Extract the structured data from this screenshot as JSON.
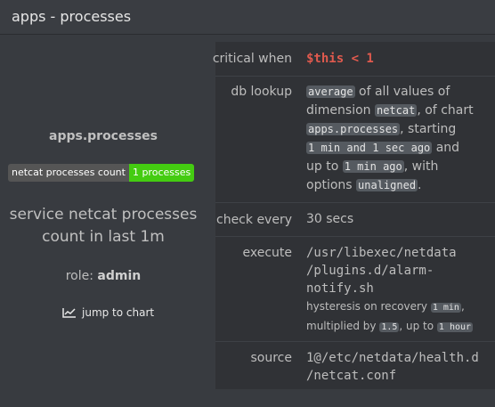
{
  "header": {
    "title": "apps - processes"
  },
  "left": {
    "chart_name": "apps.processes",
    "badge_label": "netcat processes count",
    "badge_value": "1 processes",
    "info_line1": "service netcat processes",
    "info_line2": "count in last 1m",
    "role_label": "role: ",
    "role_value": "admin",
    "jump_label": "jump to chart"
  },
  "table": {
    "critical": {
      "key": "critical when",
      "value": "$this < 1"
    },
    "lookup": {
      "key": "db lookup",
      "p1": "average",
      "t1": " of all values of",
      "t2": "dimension ",
      "p2": "netcat",
      "t3": ", of chart",
      "p3": "apps.processes",
      "t4": ", starting",
      "p4": "1 min and 1 sec ago",
      "t5": " and",
      "t6": "up to ",
      "p5": "1 min ago",
      "t7": ", with",
      "t8": "options ",
      "p6": "unaligned",
      "t9": "."
    },
    "check": {
      "key": "check every",
      "value": "30 secs"
    },
    "execute": {
      "key": "execute",
      "line1": "/usr/libexec/netdata",
      "line2": "/plugins.d/alarm-",
      "line3": "notify.sh",
      "h1": "hysteresis on recovery ",
      "hp1": "1 min",
      "h2": ",",
      "h3": "multiplied by ",
      "hp2": "1.5",
      "h4": ", up to ",
      "hp3": "1 hour"
    },
    "source": {
      "key": "source",
      "line1": "1@/etc/netdata/health.d",
      "line2": "/netcat.conf"
    }
  }
}
